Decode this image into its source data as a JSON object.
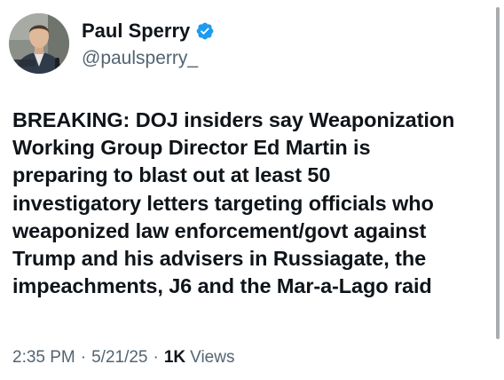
{
  "author": {
    "display_name": "Paul Sperry",
    "handle": "@paulsperry_",
    "verified": true,
    "verified_badge_color": "#1d9bf0"
  },
  "tweet": {
    "text_lines": [
      "BREAKING: DOJ insiders say Weaponization",
      "Working Group Director Ed Martin is",
      "preparing to blast out at least 50",
      "investigatory letters targeting officials who",
      "weaponized law enforcement/govt against",
      "Trump and his advisers in Russiagate, the",
      "impeachments, J6 and the Mar-a-Lago raid"
    ]
  },
  "meta": {
    "time": "2:35 PM",
    "date": "5/21/25",
    "separator": "·",
    "views_count": "1K",
    "views_label": "Views"
  },
  "colors": {
    "text_primary": "#0f1419",
    "text_secondary": "#536471",
    "scrollbar": "#a9acaf"
  },
  "icons": {
    "verified": "verified-badge-icon"
  }
}
